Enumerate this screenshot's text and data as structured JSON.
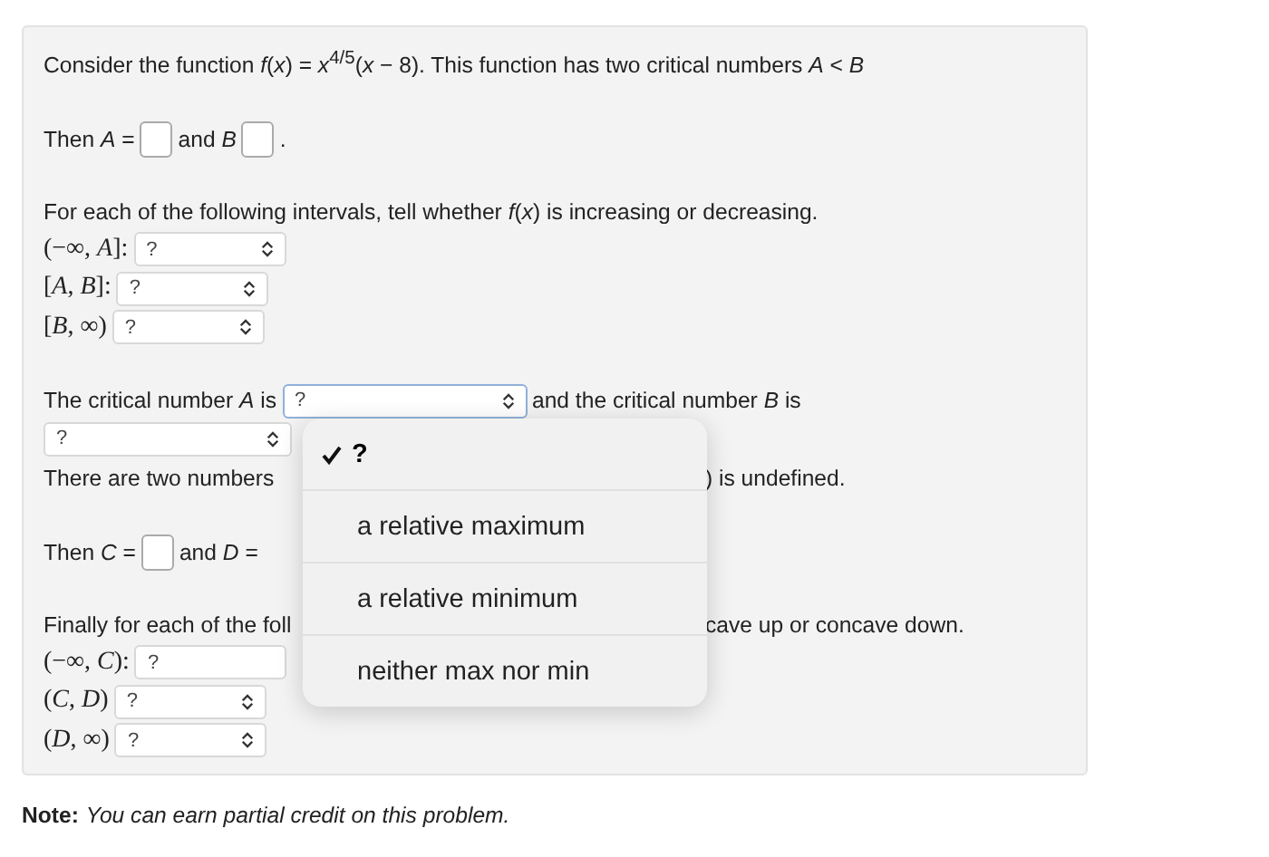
{
  "problem": {
    "intro": "Consider the function *f*(*x*) = *x*$^{4/5}$(*x* − 8). This function has two critical numbers *A* < *B*",
    "answer_line_1": {
      "prefix": "Then *A* =",
      "middle": "and *B*",
      "suffix": "."
    },
    "question_1": "For each of the following intervals, tell whether *f*(*x*) is increasing or decreasing.",
    "intervals_1": [
      {
        "label": "(−∞, *A*]:",
        "value": "?",
        "cut": false
      },
      {
        "label": "[*A*, *B*]:",
        "value": "?",
        "cut": false
      },
      {
        "label": "[*B*, ∞)",
        "value": "?",
        "cut": false
      }
    ],
    "critical_line": {
      "prefix": "The critical number *A* is",
      "select": "?",
      "suffix": "and the critical number *B* is",
      "select_2": "?"
    },
    "undefined_line": {
      "left": "There are two numbers",
      "right": ") is undefined."
    },
    "answer_line_2": {
      "prefix": "Then *C* =",
      "middle": "and *D* ="
    },
    "question_2": {
      "left": "Finally for each of the foll",
      "right": "cave up or concave down."
    },
    "intervals_2": [
      {
        "label": "(−∞, *C*):",
        "value": "?",
        "cut": true
      },
      {
        "label": "(*C*, *D*)",
        "value": "?",
        "cut": false
      },
      {
        "label": "(*D*, ∞)",
        "value": "?",
        "cut": false
      }
    ]
  },
  "dropdown_menu": {
    "options": [
      {
        "label": "?",
        "selected": true
      },
      {
        "label": "a relative maximum",
        "selected": false
      },
      {
        "label": "a relative minimum",
        "selected": false
      },
      {
        "label": "neither max nor min",
        "selected": false
      }
    ]
  },
  "note": {
    "label": "Note:",
    "text": "You can earn partial credit on this problem."
  }
}
